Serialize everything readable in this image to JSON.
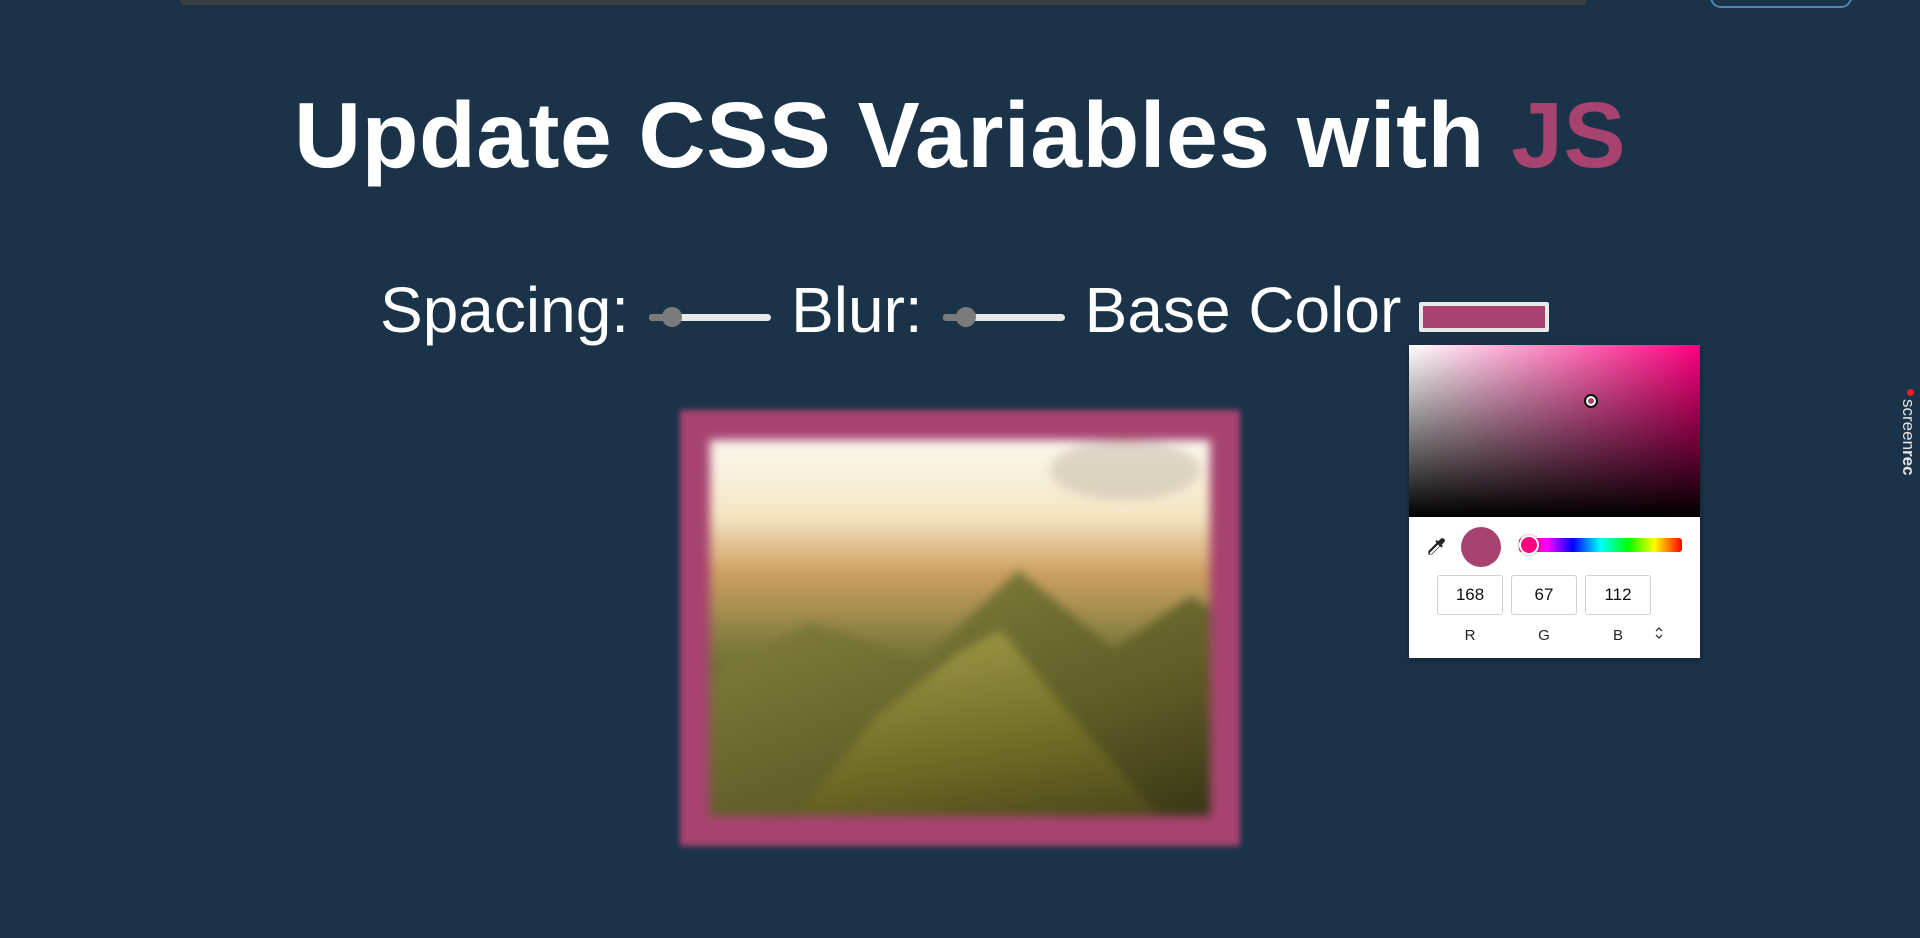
{
  "title": {
    "main": "Update CSS Variables with",
    "accent": "JS"
  },
  "controls": {
    "spacing_label": "Spacing:",
    "blur_label": "Blur:",
    "base_color_label": "Base Color"
  },
  "colors": {
    "background": "#1b3349",
    "base": "#a84370",
    "hue": "#ff0080"
  },
  "slider_levels": {
    "spacing": 0.1,
    "blur": 0.1
  },
  "color_picker": {
    "r": "168",
    "g": "67",
    "b": "112",
    "r_label": "R",
    "g_label": "G",
    "b_label": "B",
    "mode_toggle": "⇕"
  },
  "recorder": {
    "light": "screen",
    "bold": "rec"
  }
}
